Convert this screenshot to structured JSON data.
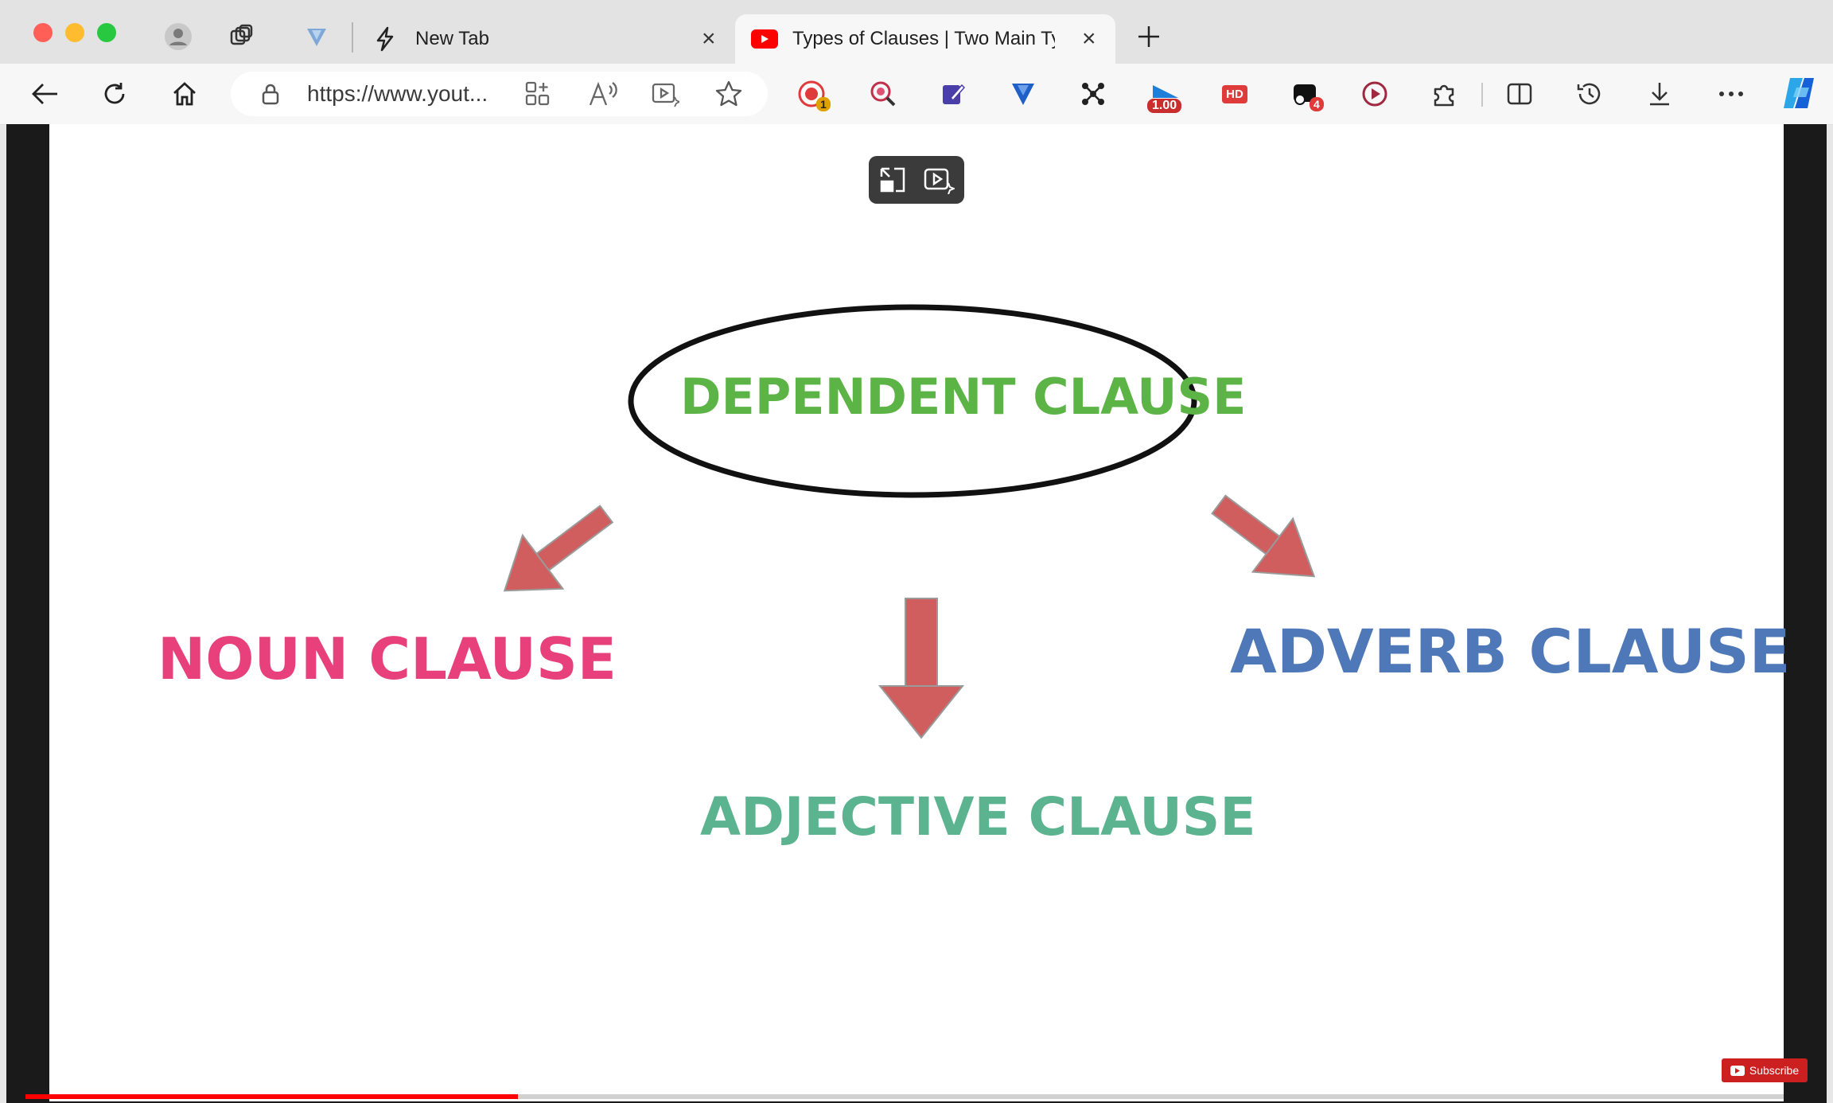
{
  "browser": {
    "tabs": [
      {
        "title": "New Tab"
      },
      {
        "title": "Types of Clauses | Two Main Ty"
      }
    ],
    "address": {
      "url": "https://www.yout..."
    },
    "extensions": [
      {
        "name": "recorder-ext-icon",
        "badge": "1"
      },
      {
        "name": "zoom-ext-icon"
      },
      {
        "name": "edit-ext-icon"
      },
      {
        "name": "vpn-ext-icon"
      },
      {
        "name": "pattern-ext-icon"
      },
      {
        "name": "speed-ext-icon",
        "badge": "1.00"
      },
      {
        "name": "hd-ext-icon",
        "label": "HD"
      },
      {
        "name": "theater-ext-icon",
        "badge": "4"
      },
      {
        "name": "screen-recorder-ext-icon"
      }
    ]
  },
  "video": {
    "diagram": {
      "root": "DEPENDENT CLAUSE",
      "left": "NOUN CLAUSE",
      "center": "ADJECTIVE CLAUSE",
      "right": "ADVERB CLAUSE"
    },
    "colors": {
      "root": "#5cb346",
      "left": "#e8407a",
      "center": "#5bb38f",
      "right": "#4f78b8",
      "arrow": "#d05e5e"
    },
    "progress": 0.28,
    "subscribe_label": "Subscribe"
  }
}
